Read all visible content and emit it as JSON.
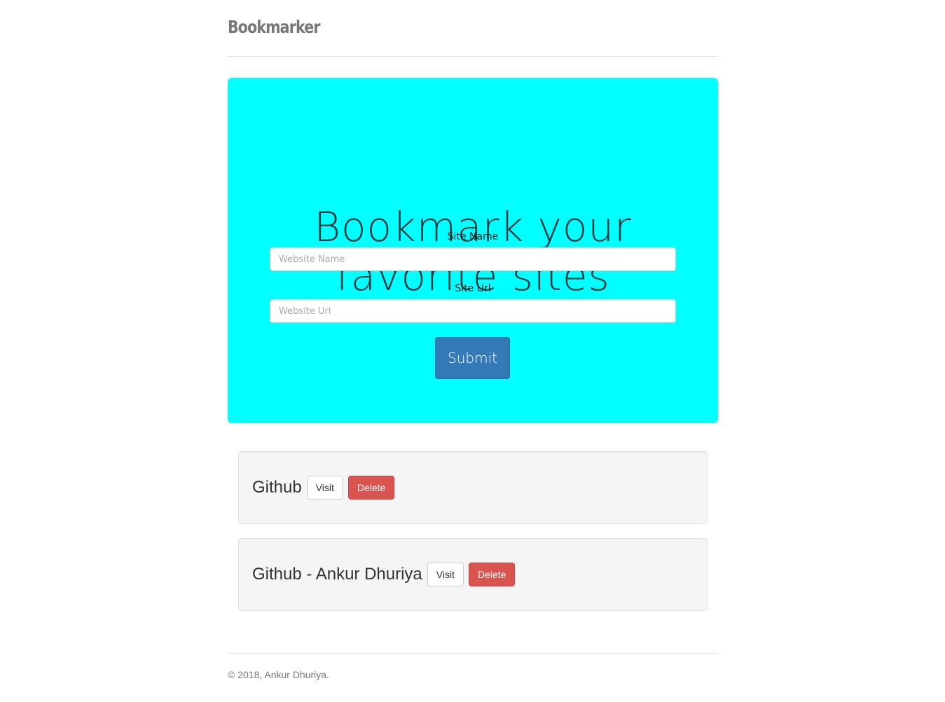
{
  "header": {
    "brand": "Bookmarker"
  },
  "hero": {
    "title_line1": "Bookmark your",
    "title_line2": "favorite sites",
    "site_name_label": "Site Name",
    "site_name_placeholder": "Website Name",
    "site_url_label": "Site Url",
    "site_url_placeholder": "Website Url",
    "submit_label": "Submit",
    "background_color": "#00ffff"
  },
  "bookmarks": [
    {
      "name": "Github",
      "visit_label": "Visit",
      "delete_label": "Delete"
    },
    {
      "name": "Github - Ankur Dhuriya",
      "visit_label": "Visit",
      "delete_label": "Delete"
    }
  ],
  "footer": {
    "copyright": "© 2018, Ankur Dhuriya."
  },
  "colors": {
    "primary": "#337ab7",
    "danger": "#d9534f"
  }
}
